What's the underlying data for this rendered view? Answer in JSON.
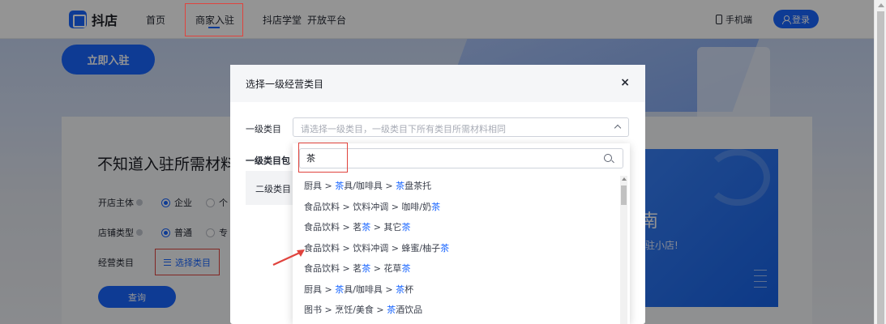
{
  "topnav": {
    "logo_text": "抖店",
    "items": [
      "首页",
      "商家入驻",
      "抖店学堂",
      "开放平台"
    ],
    "phone_label": "手机端",
    "login_label": "登录"
  },
  "hero": {
    "join_label": "立即入驻"
  },
  "card": {
    "title": "不知道入驻所需材料",
    "fields": {
      "entity_label": "开店主体",
      "entity_option1": "企业",
      "entity_option2": "个",
      "shop_type_label": "店铺类型",
      "shop_type_option1": "普通",
      "shop_type_option2": "专",
      "category_label": "经营类目",
      "select_category_label": "选择类目"
    },
    "query_label": "查询"
  },
  "banner": {
    "big_text": "南",
    "sub_text": "驻小店!"
  },
  "modal": {
    "title": "选择一级经营类目",
    "close": "×",
    "primary_label": "一级类目",
    "primary_placeholder": "请选择一级类目，一级类目下所有类目所需材料相同",
    "includes_label": "一级类目包",
    "secondary_label": "二级类目"
  },
  "dropdown": {
    "search_value": "茶",
    "results": [
      [
        {
          "t": "厨具 > "
        },
        {
          "t": "茶",
          "h": true
        },
        {
          "t": "具/咖啡具 > "
        },
        {
          "t": "茶",
          "h": true
        },
        {
          "t": "盘茶托"
        }
      ],
      [
        {
          "t": "食品饮料 > 饮料冲调 > 咖啡/奶"
        },
        {
          "t": "茶",
          "h": true
        }
      ],
      [
        {
          "t": "食品饮料 > 茗"
        },
        {
          "t": "茶",
          "h": true
        },
        {
          "t": " > 其它"
        },
        {
          "t": "茶",
          "h": true
        }
      ],
      [
        {
          "t": "食品饮料 > 饮料冲调 > 蜂蜜/柚子"
        },
        {
          "t": "茶",
          "h": true
        }
      ],
      [
        {
          "t": "食品饮料 > 茗"
        },
        {
          "t": "茶",
          "h": true
        },
        {
          "t": " > 花草"
        },
        {
          "t": "茶",
          "h": true
        }
      ],
      [
        {
          "t": "厨具 > "
        },
        {
          "t": "茶",
          "h": true
        },
        {
          "t": "具/咖啡具 > "
        },
        {
          "t": "茶",
          "h": true
        },
        {
          "t": "杯"
        }
      ],
      [
        {
          "t": "图书 > 烹饪/美食 > "
        },
        {
          "t": "茶",
          "h": true
        },
        {
          "t": "酒饮品"
        }
      ]
    ]
  },
  "colors": {
    "accent": "#1966ff",
    "highlight_box": "#e0433d"
  }
}
